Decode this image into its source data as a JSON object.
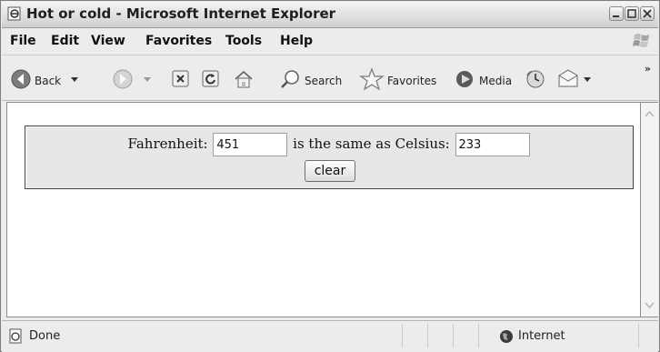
{
  "window": {
    "title": "Hot or cold - Microsoft Internet Explorer",
    "controls": [
      "minimize",
      "maximize",
      "close"
    ]
  },
  "menu": {
    "items": [
      "File",
      "Edit",
      "View",
      "Favorites",
      "Tools",
      "Help"
    ]
  },
  "toolbar": {
    "back_label": "Back",
    "search_label": "Search",
    "favorites_label": "Favorites",
    "media_label": "Media",
    "icons": [
      "back-icon",
      "forward-icon",
      "stop-icon",
      "refresh-icon",
      "home-icon",
      "search-icon",
      "favorites-star-icon",
      "media-icon",
      "history-icon",
      "mail-icon"
    ]
  },
  "form": {
    "fahrenheit_label": "Fahrenheit:",
    "fahrenheit_value": "451",
    "middle_text": "is the same as Celsius:",
    "celsius_value": "233",
    "clear_label": "clear"
  },
  "status": {
    "text": "Done",
    "zone": "Internet"
  }
}
